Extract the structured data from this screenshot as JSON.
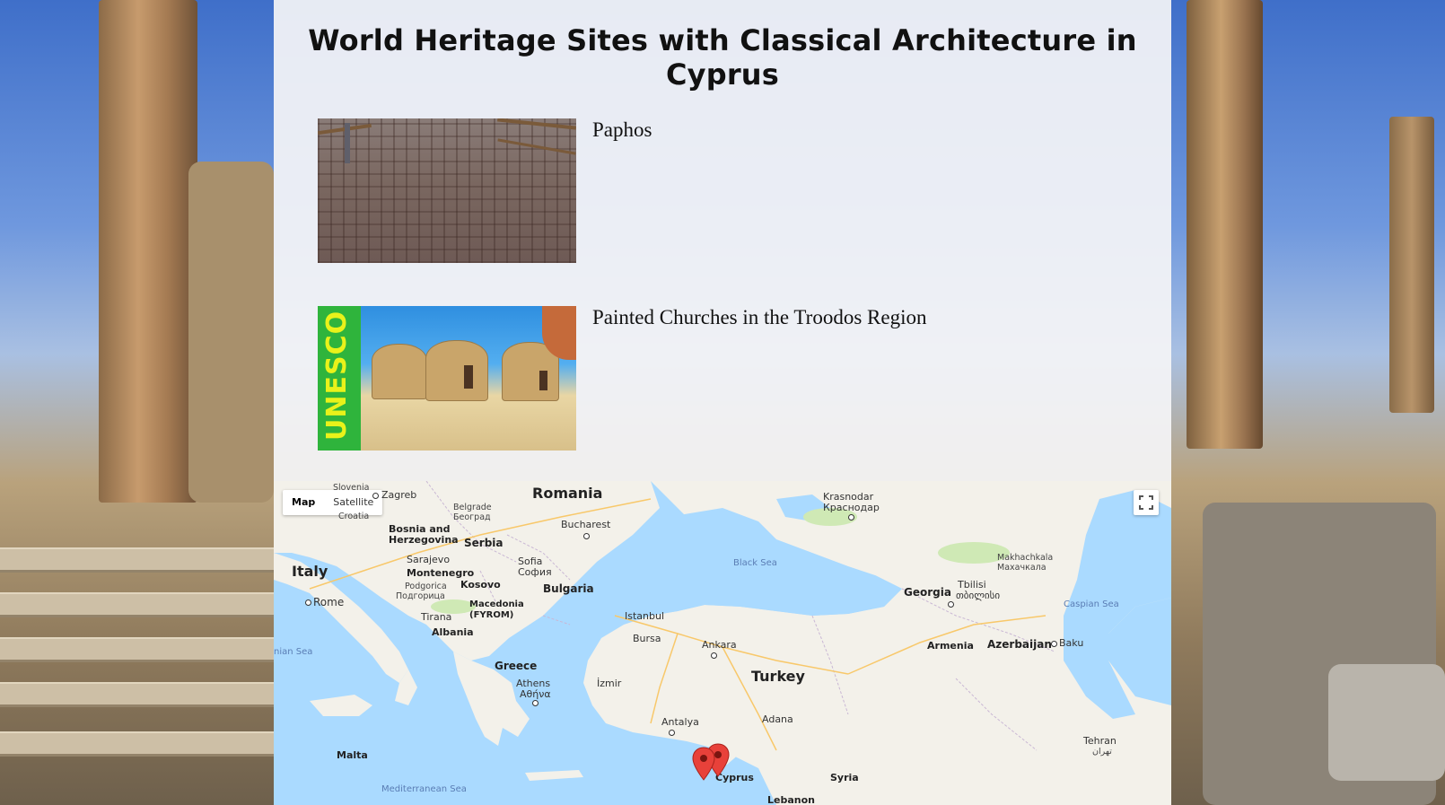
{
  "page": {
    "title": "World Heritage Sites with Classical Architecture in Cyprus"
  },
  "sites": [
    {
      "name": "Paphos",
      "image": "mosaic-floor-photo"
    },
    {
      "name": "Painted Churches in the Troodos Region",
      "image": "unesco-roundhouses-photo",
      "badge": "UNESCO"
    }
  ],
  "map": {
    "type_map": "Map",
    "type_satellite": "Satellite",
    "active_type": "Map",
    "fullscreen_icon": "fullscreen-icon",
    "marker_icon": "red-map-pin",
    "labels": {
      "slovenia": "Slovenia",
      "zagreb": "Zagreb",
      "croatia": "Croatia",
      "romania": "Romania",
      "belgrade": "Belgrade",
      "belgrade_sr": "Београд",
      "bucharest": "Bucharest",
      "krasnodar": "Krasnodar",
      "krasnodar_ru": "Краснодар",
      "bosnia": "Bosnia and Herzegovina",
      "serbia": "Serbia",
      "sarajevo": "Sarajevo",
      "sofia": "Sofia",
      "sofia_bg": "София",
      "black_sea": "Black Sea",
      "makhachkala": "Makhachkala",
      "makhachkala_ru": "Махачкала",
      "italy": "Italy",
      "montenegro": "Montenegro",
      "bulgaria": "Bulgaria",
      "podgorica": "Podgorica",
      "podgorica_sr": "Подгорица",
      "kosovo": "Kosovo",
      "tbilisi": "Tbilisi",
      "tbilisi_ka": "თბილისი",
      "rome": "Rome",
      "georgia": "Georgia",
      "caspian_sea": "Caspian Sea",
      "macedonia": "Macedonia (FYROM)",
      "tirana": "Tirana",
      "istanbul": "Istanbul",
      "albania": "Albania",
      "bursa": "Bursa",
      "ankara": "Ankara",
      "armenia": "Armenia",
      "azerbaijan": "Azerbaijan",
      "baku": "Baku",
      "ionian_sea": "nian Sea",
      "greece": "Greece",
      "turkey": "Turkey",
      "athens": "Athens",
      "athens_gr": "Αθήνα",
      "izmir": "İzmir",
      "antalya": "Antalya",
      "adana": "Adana",
      "malta": "Malta",
      "tehran": "Tehran",
      "tehran_fa": "تهران",
      "cyprus": "Cyprus",
      "syria": "Syria",
      "mediterranean": "Mediterranean Sea",
      "lebanon": "Lebanon"
    }
  },
  "colors": {
    "land": "#f3f1ea",
    "water": "#aadaff",
    "park": "#cfe9b5",
    "marker": "#e8413a",
    "panel": "#f4f4f6"
  }
}
